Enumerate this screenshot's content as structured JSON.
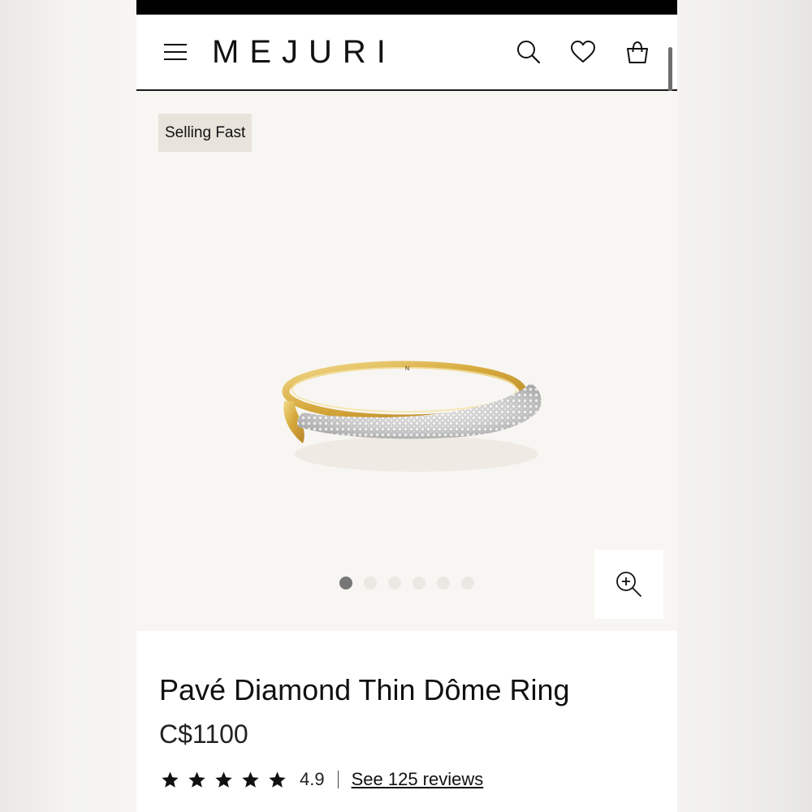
{
  "header": {
    "logo": "MEJURI"
  },
  "gallery": {
    "badge": "Selling Fast",
    "image_count": 6,
    "active_index": 0,
    "ring_engraving": "N"
  },
  "product": {
    "title": "Pavé Diamond Thin Dôme Ring",
    "price": "C$1100",
    "rating": "4.9",
    "rating_stars": 5,
    "reviews_link": "See 125 reviews"
  },
  "colors": {
    "text": "#111111",
    "gallery_bg": "#f8f6f2",
    "badge_bg": "#e8e4dc",
    "dot_active": "#777777",
    "dot_inactive": "#ebe8e3",
    "gold": "#d9b24a"
  },
  "icons": [
    "menu-icon",
    "search-icon",
    "heart-icon",
    "bag-icon",
    "zoom-in-icon",
    "star-icon"
  ]
}
